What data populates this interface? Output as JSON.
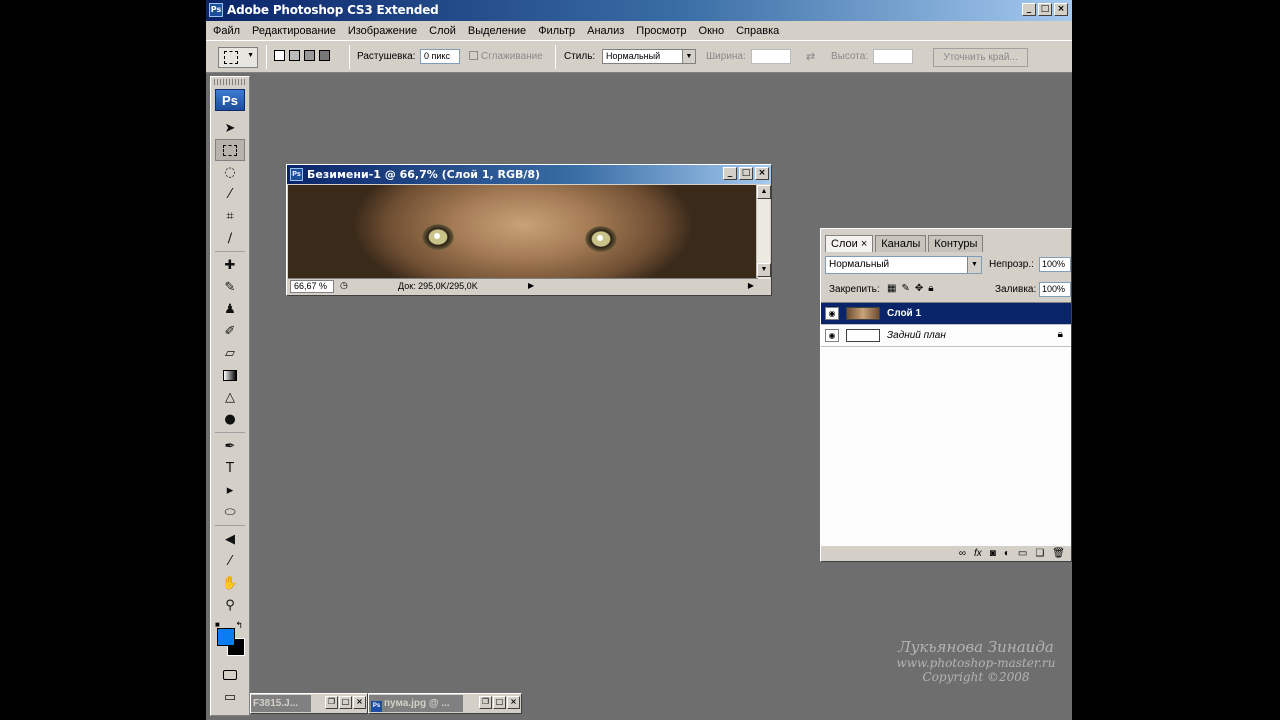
{
  "app": {
    "title": "Adobe Photoshop CS3 Extended",
    "icon": "ps-app-icon"
  },
  "menu": [
    "Файл",
    "Редактирование",
    "Изображение",
    "Слой",
    "Выделение",
    "Фильтр",
    "Анализ",
    "Просмотр",
    "Окно",
    "Справка"
  ],
  "options": {
    "feather_label": "Растушевка:",
    "feather_value": "0 пикс",
    "antialias_label": "Сглаживание",
    "style_label": "Стиль:",
    "style_value": "Нормальный",
    "width_label": "Ширина:",
    "height_label": "Высота:",
    "refine_button": "Уточнить край..."
  },
  "toolbox": {
    "logo": "Ps"
  },
  "document": {
    "title": "Безимени-1 @ 66,7% (Слой 1, RGB/8)",
    "zoom": "66,67 %",
    "doc_info": "Док: 295,0K/295,0K"
  },
  "layers_panel": {
    "tabs": [
      "Слои",
      "Каналы",
      "Контуры"
    ],
    "blend_mode": "Нормальный",
    "opacity_label": "Непрозр.:",
    "opacity_value": "100%",
    "lock_label": "Закрепить:",
    "fill_label": "Заливка:",
    "fill_value": "100%",
    "layers": [
      {
        "name": "Слой 1",
        "selected": true
      },
      {
        "name": "Задний план",
        "selected": false,
        "locked": true
      }
    ]
  },
  "minimized": [
    {
      "title": "F3815.J..."
    },
    {
      "title": "пума.jpg @ ..."
    }
  ],
  "watermark": {
    "author": "Лукьянова Зинаида",
    "site": "www.photoshop-master.ru",
    "copyright": "Copyright ©2008"
  },
  "colors": {
    "foreground": "#0a7df0",
    "background": "#000000",
    "workspace": "#6e6e6e",
    "titlebar": "#0a246a"
  }
}
